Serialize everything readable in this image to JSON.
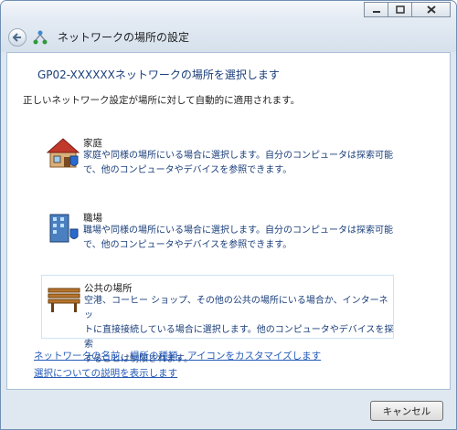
{
  "window": {
    "title": "ネットワークの場所の設定",
    "icons": {
      "back": "back-arrow-icon",
      "network": "network-icon",
      "minimize": "minimize-icon",
      "maximize": "maximize-icon",
      "close": "close-icon"
    }
  },
  "main": {
    "heading": "GP02-XXXXXXネットワークの場所を選択します",
    "subtext": "正しいネットワーク設定が場所に対して自動的に適用されます。",
    "options": [
      {
        "title": "家庭",
        "desc_line1": "家庭や同様の場所にいる場合に選択します。自分のコンピュータは探索可能",
        "desc_line2": "で、他のコンピュータやデバイスを参照できます。",
        "icon": "home-icon"
      },
      {
        "title": "職場",
        "desc_line1": "職場や同様の場所にいる場合に選択します。自分のコンピュータは探索可能",
        "desc_line2": "で、他のコンピュータやデバイスを参照できます。",
        "icon": "work-building-icon"
      },
      {
        "title": "公共の場所",
        "desc_line1": "空港、コーヒー ショップ、その他の公共の場所にいる場合か、インターネッ",
        "desc_line2": "トに直接接続している場合に選択します。他のコンピュータやデバイスを探索",
        "desc_line3": "することは制限されます。",
        "icon": "park-bench-icon"
      }
    ],
    "links": {
      "customize": "ネットワークの名前、場所の種類、アイコンをカスタマイズします",
      "explain": "選択についての説明を表示します"
    }
  },
  "footer": {
    "cancel_label": "キャンセル"
  },
  "colors": {
    "heading": "#1a3e7a",
    "link": "#2459b8",
    "frame": "#dfe8f1"
  }
}
